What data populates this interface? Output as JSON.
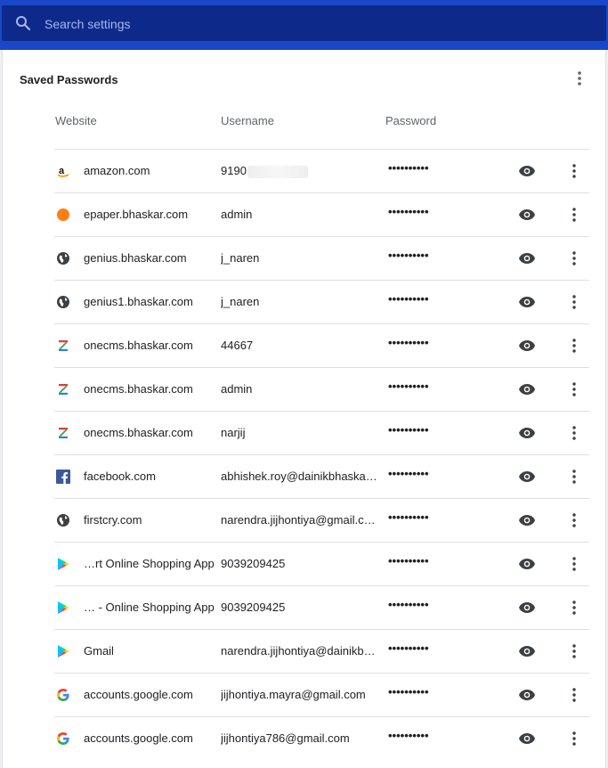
{
  "search": {
    "placeholder": "Search settings"
  },
  "section": {
    "title": "Saved Passwords"
  },
  "columns": {
    "website": "Website",
    "username": "Username",
    "password": "Password"
  },
  "rows": [
    {
      "site": "amazon.com",
      "user": "9190",
      "pass": "••••••••••",
      "icon": "amazon-icon",
      "user_redacted": true
    },
    {
      "site": "epaper.bhaskar.com",
      "user": "admin",
      "pass": "••••••••••",
      "icon": "orange-dot-icon"
    },
    {
      "site": "genius.bhaskar.com",
      "user": "j_naren",
      "pass": "••••••••••",
      "icon": "globe-icon"
    },
    {
      "site": "genius1.bhaskar.com",
      "user": "j_naren",
      "pass": "••••••••••",
      "icon": "globe-icon"
    },
    {
      "site": "onecms.bhaskar.com",
      "user": "44667",
      "pass": "••••••••••",
      "icon": "onecms-z-icon"
    },
    {
      "site": "onecms.bhaskar.com",
      "user": "admin",
      "pass": "••••••••••",
      "icon": "onecms-z-icon"
    },
    {
      "site": "onecms.bhaskar.com",
      "user": "narjij",
      "pass": "••••••••••",
      "icon": "onecms-z-icon"
    },
    {
      "site": "facebook.com",
      "user": "abhishek.roy@dainikbhaskar…",
      "pass": "••••••••••",
      "icon": "facebook-icon"
    },
    {
      "site": "firstcry.com",
      "user": "narendra.jijhontiya@gmail.c…",
      "pass": "••••••••••",
      "icon": "globe-icon"
    },
    {
      "site": "…rt Online Shopping App",
      "user": "9039209425",
      "pass": "••••••••••",
      "icon": "google-play-icon"
    },
    {
      "site": "… - Online Shopping App",
      "user": "9039209425",
      "pass": "••••••••••",
      "icon": "google-play-icon"
    },
    {
      "site": "Gmail",
      "user": "narendra.jijhontiya@dainikbh…",
      "pass": "••••••••••",
      "icon": "google-play-icon"
    },
    {
      "site": "accounts.google.com",
      "user": "jijhontiya.mayra@gmail.com",
      "pass": "••••••••••",
      "icon": "google-icon"
    },
    {
      "site": "accounts.google.com",
      "user": "jijhontiya786@gmail.com",
      "pass": "••••••••••",
      "icon": "google-icon"
    }
  ],
  "colors": {
    "topbar": "#1a47c8",
    "searchbox": "#0d2a8a",
    "icon_grey": "#5f6368",
    "text": "#202124"
  }
}
